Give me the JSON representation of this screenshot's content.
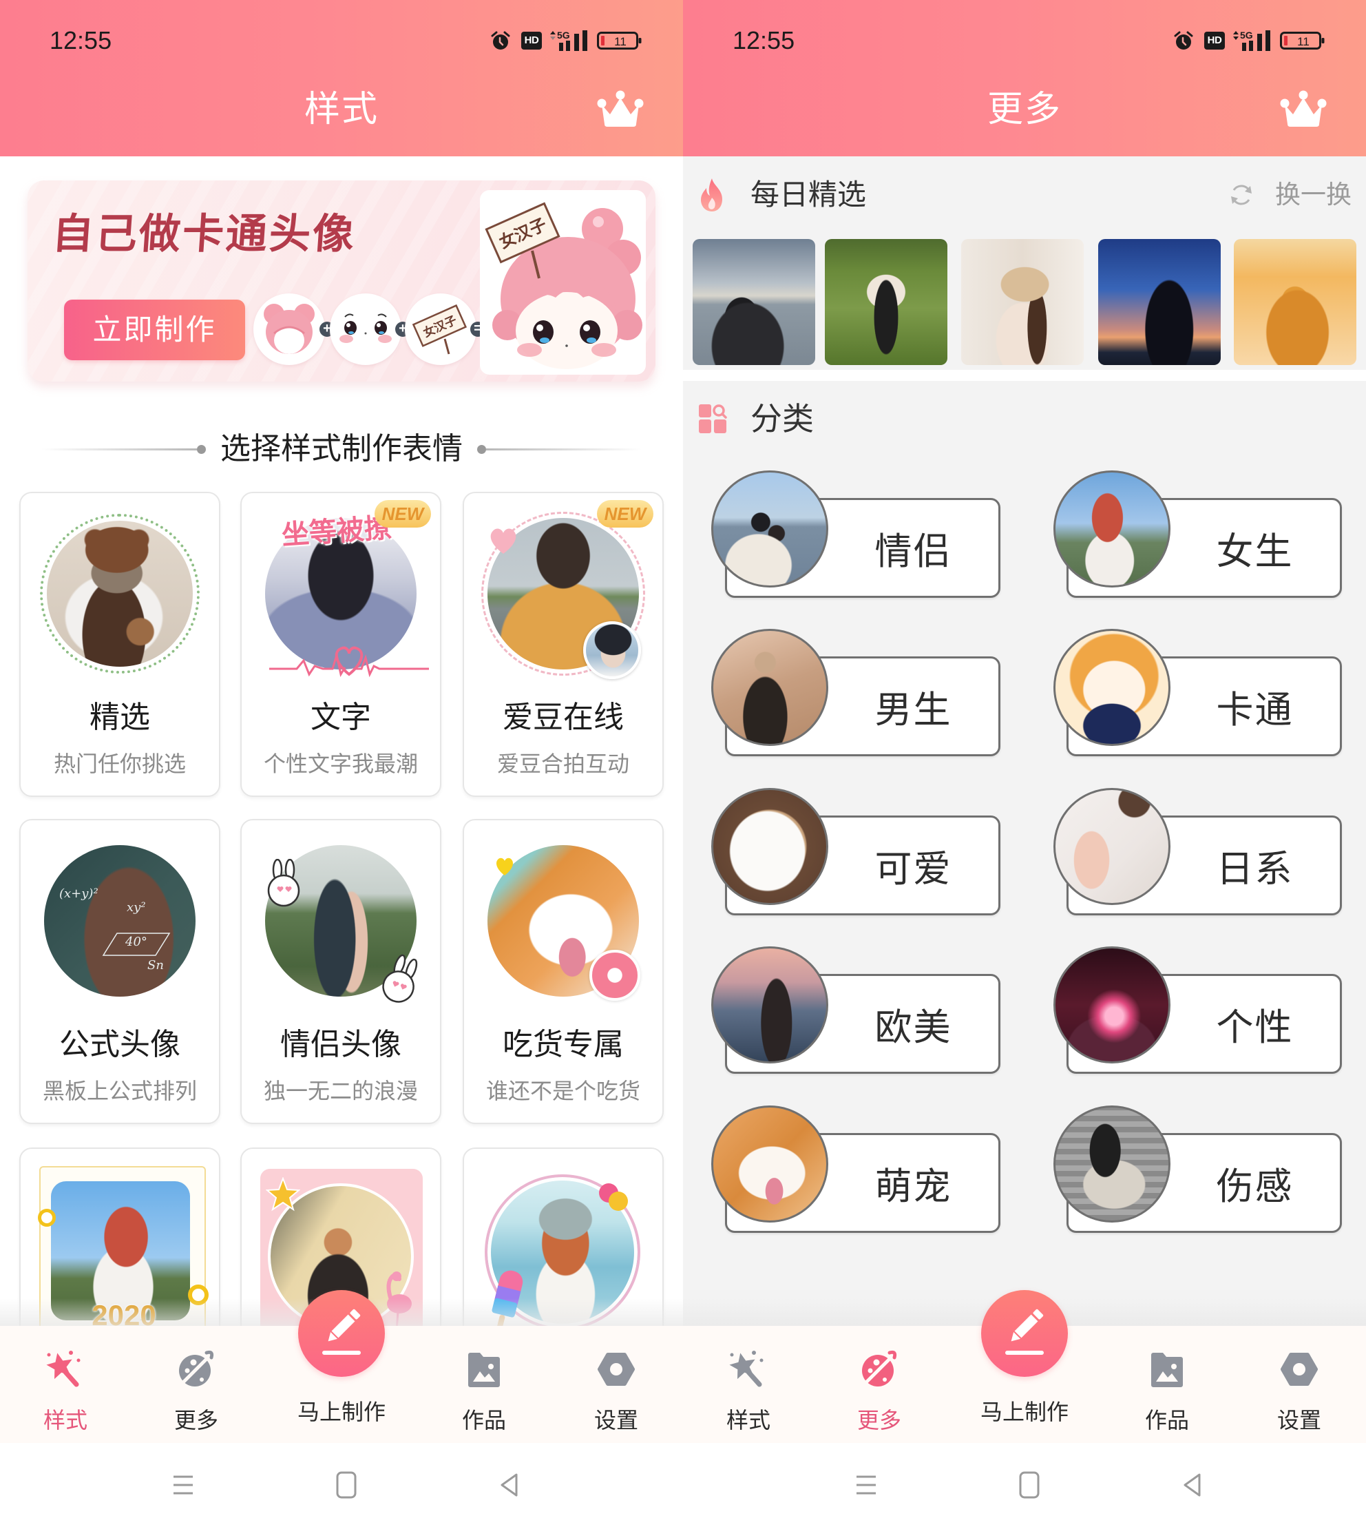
{
  "theme": {
    "header_start": "#fd7e8f",
    "header_end": "#fd9d8b",
    "accent": "#f2607f",
    "button_start": "#f7628a",
    "button_end": "#fc8a7b",
    "badge": "#f7c35b",
    "inactive": "#8e929b",
    "battery_low": "#e0303a"
  },
  "status_bar": {
    "time": "12:55",
    "hd_label": "HD",
    "network_label": "5G",
    "battery_level": "11",
    "icons": [
      "alarm-icon",
      "hd-icon",
      "signal-5g-icon",
      "battery-icon"
    ]
  },
  "bottom_nav": {
    "items": [
      {
        "label": "样式",
        "icon": "magic-wand-icon"
      },
      {
        "label": "更多",
        "icon": "planet-icon"
      },
      {
        "label": "马上制作",
        "icon": "pencil-icon"
      },
      {
        "label": "作品",
        "icon": "gallery-folder-icon"
      },
      {
        "label": "设置",
        "icon": "hex-settings-icon"
      }
    ]
  },
  "system_nav": {
    "buttons": [
      {
        "icon": "recent-apps-icon"
      },
      {
        "icon": "home-icon"
      },
      {
        "icon": "back-icon"
      }
    ]
  },
  "styles_screen": {
    "title": "样式",
    "header_action_icon": "crown-icon",
    "active_tab": 0,
    "banner": {
      "headline": "自己做卡通头像",
      "cta_label": "立即制作",
      "sign_text": "女汉子",
      "operators": [
        "+",
        "+",
        "="
      ]
    },
    "section_title": "选择样式制作表情",
    "cards": [
      {
        "title": "精选",
        "subtitle": "热门任你挑选"
      },
      {
        "title": "文字",
        "subtitle": "个性文字我最潮",
        "badge": "NEW",
        "sticker_text": "坐等被撩"
      },
      {
        "title": "爱豆在线",
        "subtitle": "爱豆合拍互动",
        "badge": "NEW"
      },
      {
        "title": "公式头像",
        "subtitle": "黑板上公式排列",
        "chalk_text": [
          "(x+y)²",
          "xy²",
          "40°",
          "Sn"
        ]
      },
      {
        "title": "情侣头像",
        "subtitle": "独一无二的浪漫"
      },
      {
        "title": "吃货专属",
        "subtitle": "谁还不是个吃货"
      },
      {
        "image_text": "2020"
      },
      {},
      {}
    ]
  },
  "more_screen": {
    "title": "更多",
    "header_action_icon": "crown-icon",
    "active_tab": 1,
    "daily": {
      "title": "每日精选",
      "refresh_label": "换一换",
      "photos": [
        {
          "subject": "couple by the sea"
        },
        {
          "subject": "girl walking on grassland"
        },
        {
          "subject": "girl with straw hat"
        },
        {
          "subject": "silhouette under night sky"
        },
        {
          "subject": "girl in golden sunset"
        }
      ]
    },
    "categories": {
      "title": "分类",
      "items": [
        {
          "label": "情侣"
        },
        {
          "label": "女生"
        },
        {
          "label": "男生"
        },
        {
          "label": "卡通"
        },
        {
          "label": "可爱"
        },
        {
          "label": "日系"
        },
        {
          "label": "欧美"
        },
        {
          "label": "个性"
        },
        {
          "label": "萌宠"
        },
        {
          "label": "伤感"
        }
      ]
    }
  }
}
